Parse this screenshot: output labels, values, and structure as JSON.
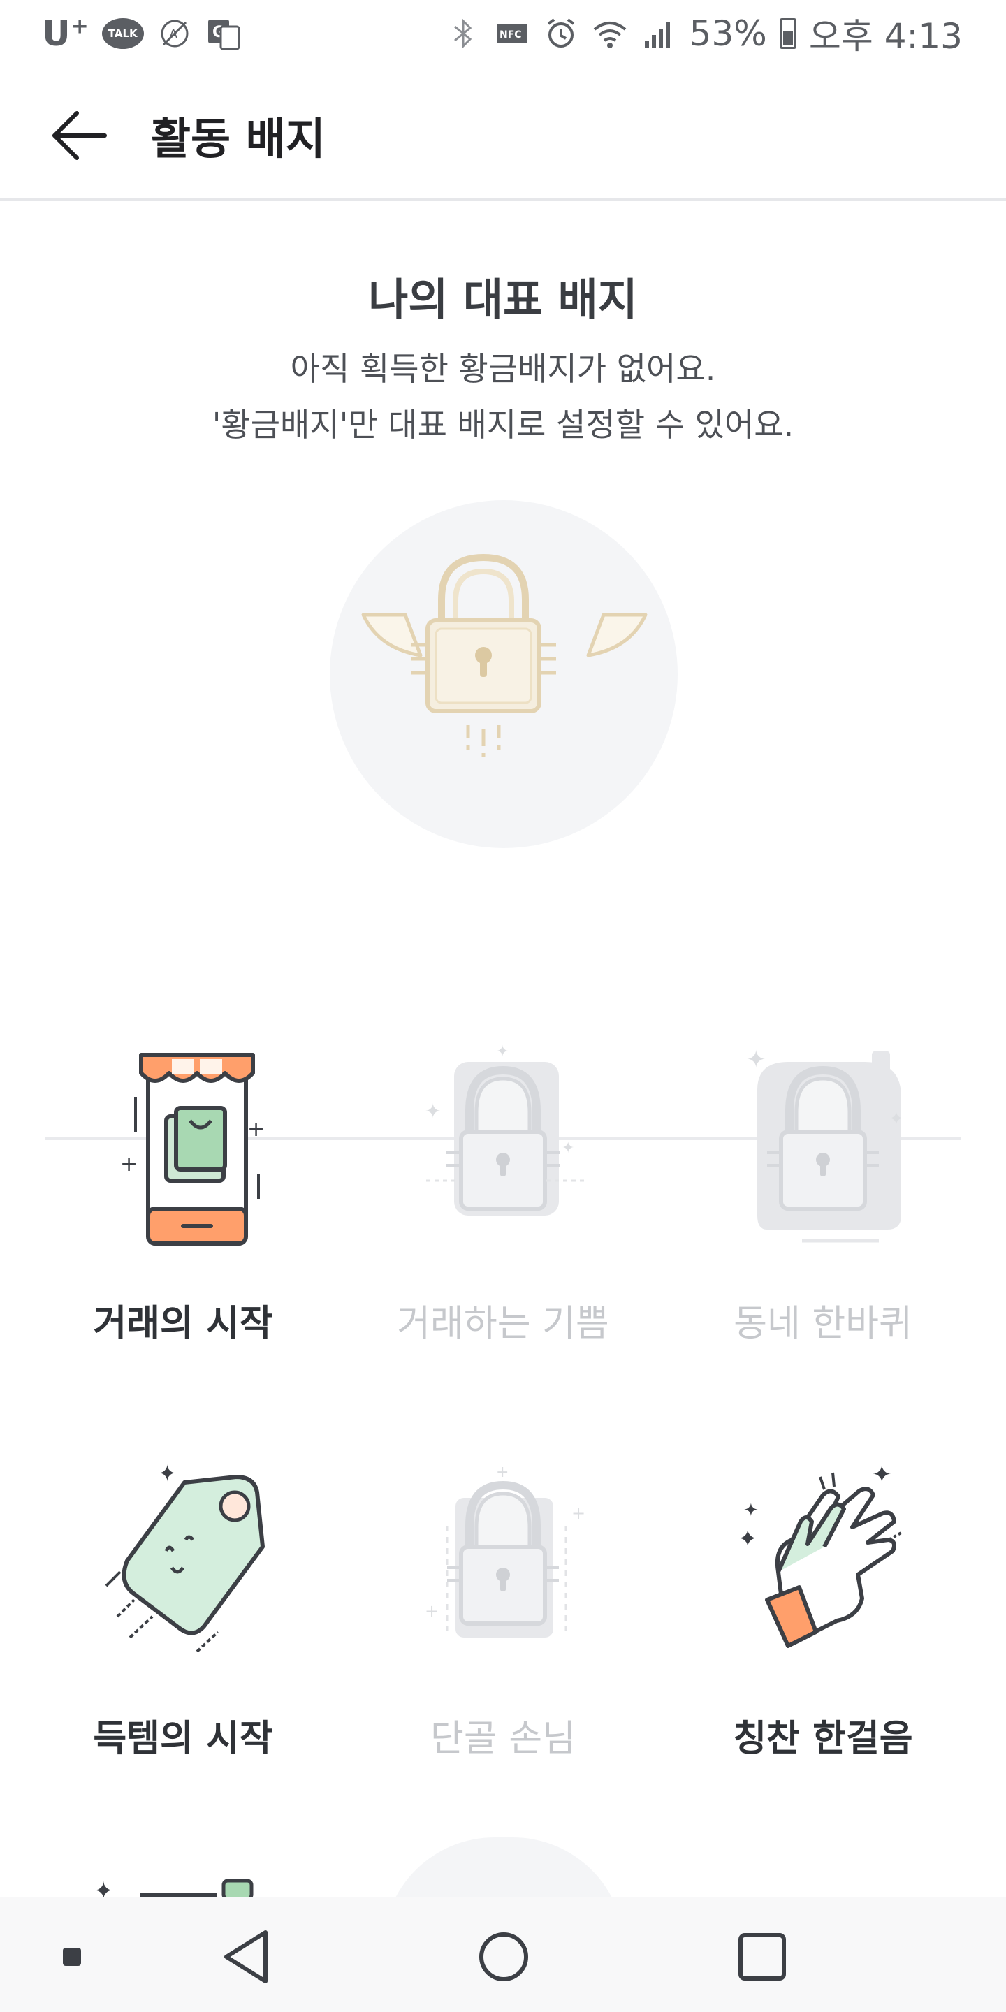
{
  "status_bar": {
    "carrier": "U",
    "carrier_sup": "+",
    "talk_icon_text": "TALK",
    "battery": "53%",
    "time": "오후 4:13",
    "icons": [
      "kakaotalk-icon",
      "translate-icon",
      "google-translate-icon",
      "bluetooth-icon",
      "nfc-icon",
      "alarm-icon",
      "wifi-icon",
      "signal-icon",
      "battery-icon"
    ]
  },
  "appbar": {
    "title": "활동 배지",
    "back_icon": "arrow-left-icon"
  },
  "representative": {
    "title": "나의 대표 배지",
    "desc_line1": "아직 획득한 황금배지가 없어요.",
    "desc_line2": "'황금배지'만 대표 배지로 설정할 수 있어요.",
    "icon": "winged-lock-icon"
  },
  "badges": [
    {
      "label": "거래의 시작",
      "locked": false,
      "icon": "phone-shop-icon"
    },
    {
      "label": "거래하는 기쁨",
      "locked": true,
      "icon": "lock-icon"
    },
    {
      "label": "동네 한바퀴",
      "locked": true,
      "icon": "lock-icon"
    },
    {
      "label": "득템의 시작",
      "locked": false,
      "icon": "price-tag-icon"
    },
    {
      "label": "단골 손님",
      "locked": true,
      "icon": "lock-icon"
    },
    {
      "label": "칭찬 한걸음",
      "locked": false,
      "icon": "clapping-hands-icon"
    }
  ],
  "colors": {
    "accent_orange": "#ff9f6b",
    "mint": "#d4eedd",
    "lock_gold": "#e8d9bb",
    "locked_gray": "#d6d8dc"
  },
  "navbar": {
    "buttons": [
      "recent-dot-icon",
      "back-triangle-icon",
      "home-circle-icon",
      "overview-square-icon"
    ]
  }
}
